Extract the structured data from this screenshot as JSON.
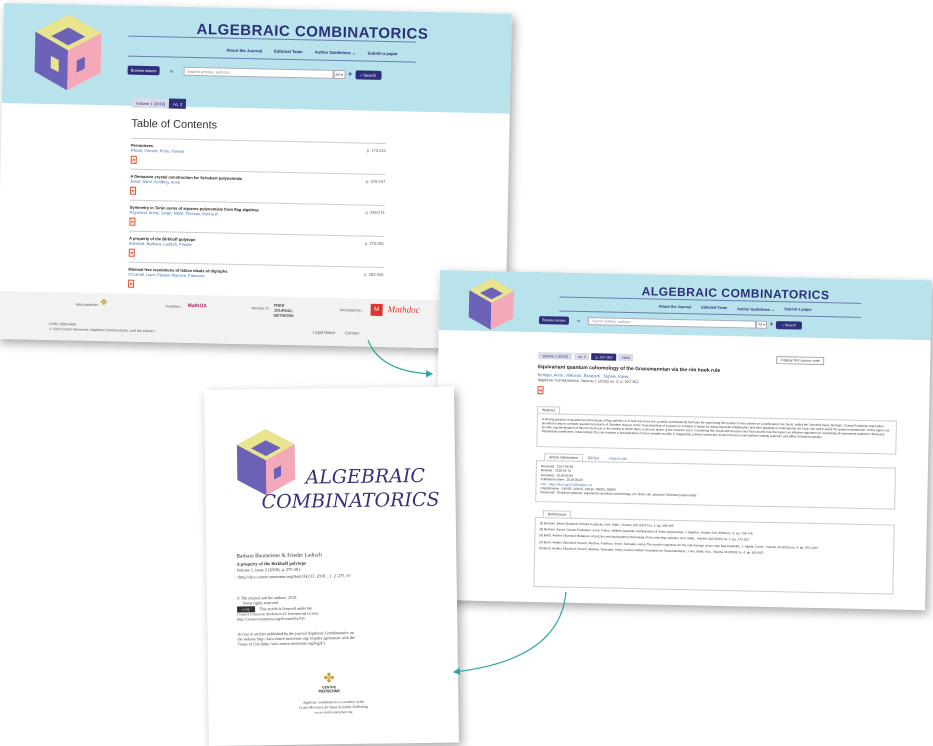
{
  "journal": {
    "name": "ALGEBRAIC COMBINATORICS",
    "logo_line1": "ALGEBRAIC",
    "logo_line2": "COMBINATORICS"
  },
  "colors": {
    "banner": "#b8e3ec",
    "navy": "#2e2e7a",
    "link": "#3d6bb5",
    "pdf": "#e04b2c",
    "arrow": "#2aa7a0"
  },
  "nav": [
    "About the Journal",
    "Editorial Team",
    "Author Guidelines ⌄",
    "Submit a paper"
  ],
  "search": {
    "browse_label": "Browse issues",
    "or_label": "or",
    "placeholder": "Search articles, authors...",
    "scope": "All ▾",
    "plus": "+",
    "search_button": "Search"
  },
  "toc_page": {
    "crumbs": [
      "Volume 1 (2018)",
      "no. 3"
    ],
    "heading": "Table of Contents",
    "items": [
      {
        "title": "Permutrees",
        "authors": "Pilaud, Vincent; Pons, Viviane",
        "pages": "p. 173-224"
      },
      {
        "title": "A Demazure crystal construction for Schubert polynomials",
        "authors": "Assaf, Sami; Schilling, Anne",
        "pages": "p. 225-247"
      },
      {
        "title": "Symmetry in Turán sums of squares polynomials from flag algebras",
        "authors": "Raymond, Annie; Singh, Mohit; Thomas, Rekha R.",
        "pages": "p. 249-274"
      },
      {
        "title": "A property of the Birkhoff polytope",
        "authors": "Barvinok, Barbara; Ladisch, Frieder",
        "pages": "p. 275-281"
      },
      {
        "title": "Minimal free resolutions of lattice ideals of digraphs",
        "authors": "O'Carroll, Liam; Planas-Vilanova, Francesc",
        "pages": "p. 283-326"
      }
    ],
    "footer": {
      "web_publisher": "Web publisher :",
      "publisher": "Publisher :",
      "member_of": "Member of :",
      "developed_by": "Developed by :",
      "issn": "ISSN: 2589-5486",
      "copyright": "© 2018 Centre Mersenne, Algebraic Combinatorics, and the authors",
      "legal": "Legal Notice",
      "contact": "Contact",
      "brand_mathdoc": "Mathdoc",
      "brand_free": "FREE JOURNAL NETWORK",
      "brand_mathos": "MathOA"
    }
  },
  "article_page": {
    "crumbs": [
      "Volume 1 (2018)",
      "no. 2",
      "p. 327-352",
      "Next"
    ],
    "display_tex": "Display TeX source code",
    "title": "Equivariant quantum cohomology of the Grassmannian via the rim hook rule",
    "authors": "Bertiger, Anna ; Milićević, Elizabeth ; Taipale, Kaisa",
    "citation": "Algebraic Combinatorics, Volume 1 (2018) no. 3, p. 327-352",
    "abstract_tab": "Abstract",
    "abstract": "A driving question in (quantum) cohomology of flag varieties is to find non-recursive, positive combinatorial formulas for expressing the product of two classes in a particularly nice basis, called the Schubert basis. Bertram, Ciocan-Fontanine and Fulton provided a way to compute quantum products of Schubert classes in the Grassmannian of k-planes in complex n-space by doing classical multiplication and then applying a combinatorial rim hook rule which yields the quantum parameter. In this paper, we provide a generalization of this rim hook rule to the setting in which there is also an action of the complex torus. Combining this result with Knutson and Tao's puzzle rule then gives an effective algorithm for computing all equivariant quantum Littlewood-Richardson coefficients. Interestingly, this rule requires a specialization of torus weights modulo n, suggesting a direct connection to the Peterson isomorphism relating quantum and affine Schubert calculus.",
    "info_tabs": [
      "Article information",
      "BibTeX",
      "How to cite"
    ],
    "info": [
      "Received : 2017-06-05",
      "Revised : 2018-01-31",
      "Accepted : 2018-02-06",
      "Published online : 2018-06-05",
      "DOI : https://doi.org/10.5802/alco.10",
      "Classification : 14N35, 14M15, 14N15, 05E05, 05E05",
      "Keywords : Schubert calculus, equivariant quantum cohomology, rim hook rule, quantum Schubert polynomials"
    ],
    "references_tab": "References",
    "references": [
      "[1] Bertram, Aaron Quantum Schubert calculus, Adv. Math., Volume 128 (1997) no. 2, pp. 289-305",
      "[2] Bertram, Aaron; Ciocan-Fontanine, Ionut; Fulton, William Quantum multiplication of Schur polynomials, J. Algebra, Volume 219 (1999) no. 2, pp. 728-746",
      "[3] Buch, Anders Skovsted Mutations of puzzles and equivariant cohomology of two-step flag varieties, Ann. Math., Volume 182 (2015) no. 1, pp. 173-220",
      "[4] Buch, Anders Skovsted; Kresch, Andrew; Purbhoo, Kevin; Tamvakis, Harry The puzzle conjecture for the cohomology of two-step flag manifolds, J. Algebr. Comb., Volume 44 (2016) no. 4, pp. 973-1007",
      "[5] Buch, Anders Skovsted; Kresch, Andrew; Tamvakis, Harry Gromov-Witten invariants on Grassmannians, J. Am. Math. Soc., Volume 16 (2003) no. 4, pp. 901-915"
    ]
  },
  "paper": {
    "authors": "Barbara Baumeister & Frieder Ladisch",
    "title": "A property of the Birkhoff polytope",
    "volume": "Volume 1, issue 2 (2018), p. 275-281.",
    "url": "<http://alco.centre-mersenne.org/item/ALCO_2018__1_2_275_0>",
    "copyright1": "© The journal and the authors, 2018.",
    "copyright2": "Some rights reserved.",
    "license1": "This article is licensed under the",
    "license2": "Creative Commons Attribution 4.0 International License.",
    "license3": "http://creativecommons.org/licenses/by/4.0/",
    "access1": "Access to articles published by the journal Algebraic Combinatorics on",
    "access2": "the website http://alco.centre-mersenne.org/ implies agreement with the",
    "access3": "Terms of Use (http://alco.centre-mersenne.org/legal/).",
    "centre1": "CENTRE",
    "centre2": "MERSENNE",
    "member1": "Algebraic Combinatorics is member of the",
    "member2": "Centre Mersenne for Open Scientific Publishing",
    "member3": "www.centre-mersenne.org"
  }
}
